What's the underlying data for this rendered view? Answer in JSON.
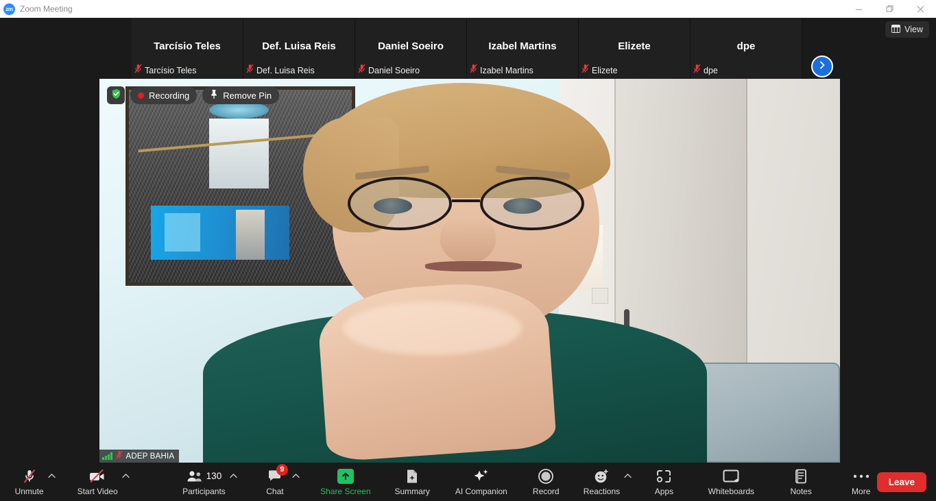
{
  "window": {
    "app_icon": "zoom-logo-icon",
    "title": "Zoom Meeting",
    "minimize_label": "Minimize",
    "maximize_label": "Restore",
    "close_label": "Close"
  },
  "topbar": {
    "view_button": {
      "label": "View",
      "icon": "grid-view-icon"
    },
    "next_page_button": {
      "icon": "chevron-right-icon"
    }
  },
  "thumbnails": [
    {
      "display_name": "Tarcísio Teles",
      "badge_name": "Tarcísio Teles",
      "muted": true,
      "mic_icon": "mic-muted-icon"
    },
    {
      "display_name": "Def. Luisa Reis",
      "badge_name": "Def. Luisa Reis",
      "muted": true,
      "mic_icon": "mic-muted-icon"
    },
    {
      "display_name": "Daniel Soeiro",
      "badge_name": "Daniel Soeiro",
      "muted": true,
      "mic_icon": "mic-muted-icon"
    },
    {
      "display_name": "Izabel Martins",
      "badge_name": "Izabel Martins",
      "muted": true,
      "mic_icon": "mic-muted-icon"
    },
    {
      "display_name": "Elizete",
      "badge_name": "Elizete",
      "muted": true,
      "mic_icon": "mic-muted-icon"
    },
    {
      "display_name": "dpe",
      "badge_name": "dpe",
      "muted": true,
      "mic_icon": "mic-muted-icon"
    }
  ],
  "stage": {
    "encryption_badge": {
      "icon": "shield-check-icon",
      "color": "#36c24a"
    },
    "recording_label": "Recording",
    "recording_dot_color": "#e02020",
    "remove_pin_label": "Remove Pin",
    "remove_pin_icon": "pin-icon",
    "active_speaker": {
      "name": "ADEP BAHIA",
      "muted": true,
      "mic_icon": "mic-muted-icon",
      "signal_icon": "signal-bars-icon",
      "signal_color": "#36c24a"
    }
  },
  "toolbar": {
    "items": [
      {
        "label": "Unmute",
        "icon": "mic-muted-icon",
        "caret": true,
        "badge": "",
        "count": "",
        "accent": ""
      },
      {
        "label": "Start Video",
        "icon": "video-off-icon",
        "caret": true,
        "badge": "",
        "count": "",
        "accent": ""
      },
      {
        "label": "Participants",
        "icon": "participants-icon",
        "caret": true,
        "badge": "",
        "count": "130",
        "accent": ""
      },
      {
        "label": "Chat",
        "icon": "chat-icon",
        "caret": true,
        "badge": "9",
        "count": "",
        "accent": ""
      },
      {
        "label": "Share Screen",
        "icon": "share-screen-icon",
        "caret": false,
        "badge": "",
        "count": "",
        "accent": "#1ec362"
      },
      {
        "label": "Summary",
        "icon": "summary-icon",
        "caret": false,
        "badge": "",
        "count": "",
        "accent": ""
      },
      {
        "label": "AI Companion",
        "icon": "sparkles-icon",
        "caret": false,
        "badge": "",
        "count": "",
        "accent": ""
      },
      {
        "label": "Record",
        "icon": "record-icon",
        "caret": false,
        "badge": "",
        "count": "",
        "accent": ""
      },
      {
        "label": "Reactions",
        "icon": "reactions-icon",
        "caret": true,
        "badge": "",
        "count": "",
        "accent": ""
      },
      {
        "label": "Apps",
        "icon": "apps-icon",
        "caret": false,
        "badge": "",
        "count": "",
        "accent": ""
      },
      {
        "label": "Whiteboards",
        "icon": "whiteboard-icon",
        "caret": false,
        "badge": "",
        "count": "",
        "accent": ""
      },
      {
        "label": "Notes",
        "icon": "notes-icon",
        "caret": false,
        "badge": "",
        "count": "",
        "accent": ""
      },
      {
        "label": "More",
        "icon": "ellipsis-icon",
        "caret": false,
        "badge": "",
        "count": "",
        "accent": ""
      }
    ],
    "leave_label": "Leave",
    "leave_color": "#e02d2d"
  }
}
